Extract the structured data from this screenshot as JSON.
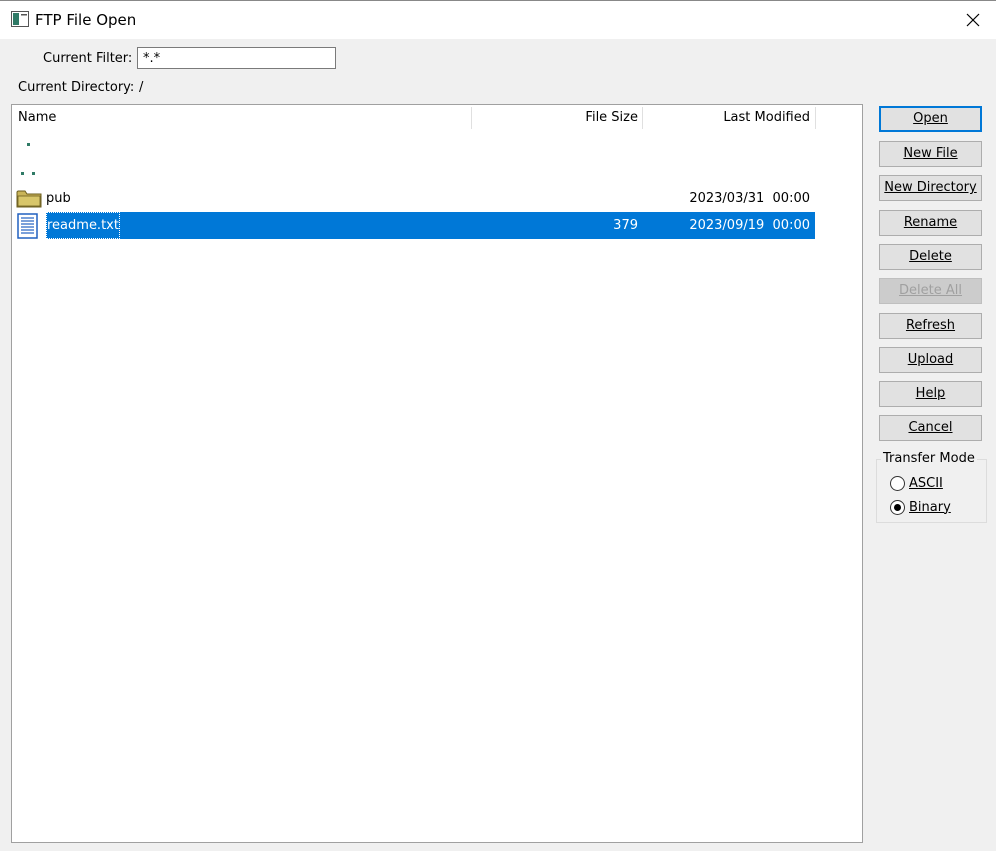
{
  "window": {
    "title": "FTP File Open",
    "close_label": "✕"
  },
  "filter": {
    "label": "Current Filter:",
    "value": "*.*"
  },
  "directory": {
    "label": "Current Directory:",
    "value": "/"
  },
  "columns": {
    "name": "Name",
    "size": "File Size",
    "modified": "Last Modified"
  },
  "rows": [
    {
      "name": ".",
      "type": "dot",
      "size": "",
      "modified": ""
    },
    {
      "name": "..",
      "type": "dotdot",
      "size": "",
      "modified": ""
    },
    {
      "name": "pub",
      "type": "folder",
      "size": "",
      "modified": "2023/03/31  00:00"
    },
    {
      "name": "readme.txt",
      "type": "file",
      "size": "379",
      "modified": "2023/09/19  00:00",
      "selected": true
    }
  ],
  "buttons": {
    "open": "Open",
    "new_file": "New File",
    "new_directory": "New Directory",
    "rename": "Rename",
    "delete": "Delete",
    "delete_all": "Delete All",
    "refresh": "Refresh",
    "upload": "Upload",
    "help": "Help",
    "cancel": "Cancel"
  },
  "transfer_mode": {
    "title": "Transfer Mode",
    "options": [
      {
        "label": "ASCII",
        "selected": false
      },
      {
        "label": "Binary",
        "selected": true
      }
    ]
  },
  "colors": {
    "selection": "#0078d7",
    "default_border": "#0078d7",
    "folder": "#c9b458",
    "file_icon": "#2060c0"
  }
}
